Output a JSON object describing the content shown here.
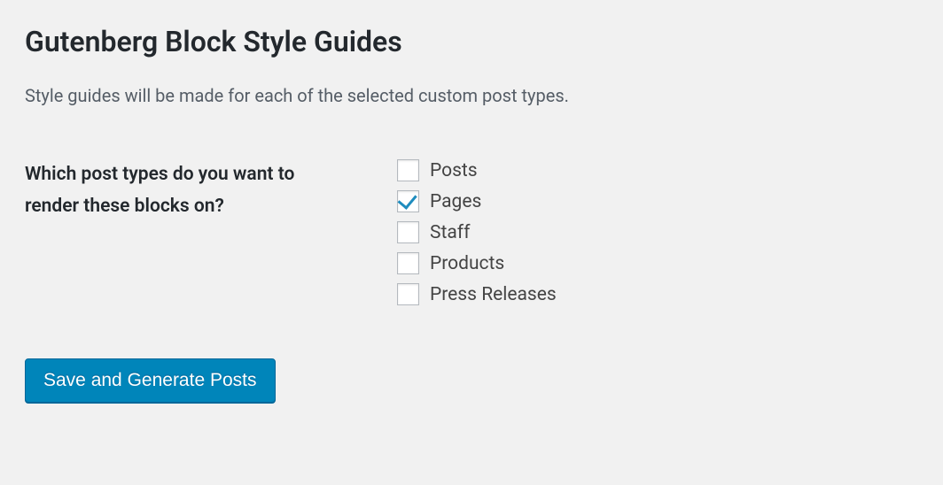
{
  "page": {
    "title": "Gutenberg Block Style Guides",
    "description": "Style guides will be made for each of the selected custom post types."
  },
  "form": {
    "label": "Which post types do you want to render these blocks on?",
    "options": [
      {
        "label": "Posts",
        "checked": false
      },
      {
        "label": "Pages",
        "checked": true
      },
      {
        "label": "Staff",
        "checked": false
      },
      {
        "label": "Products",
        "checked": false
      },
      {
        "label": "Press Releases",
        "checked": false
      }
    ],
    "submit_label": "Save and Generate Posts"
  }
}
